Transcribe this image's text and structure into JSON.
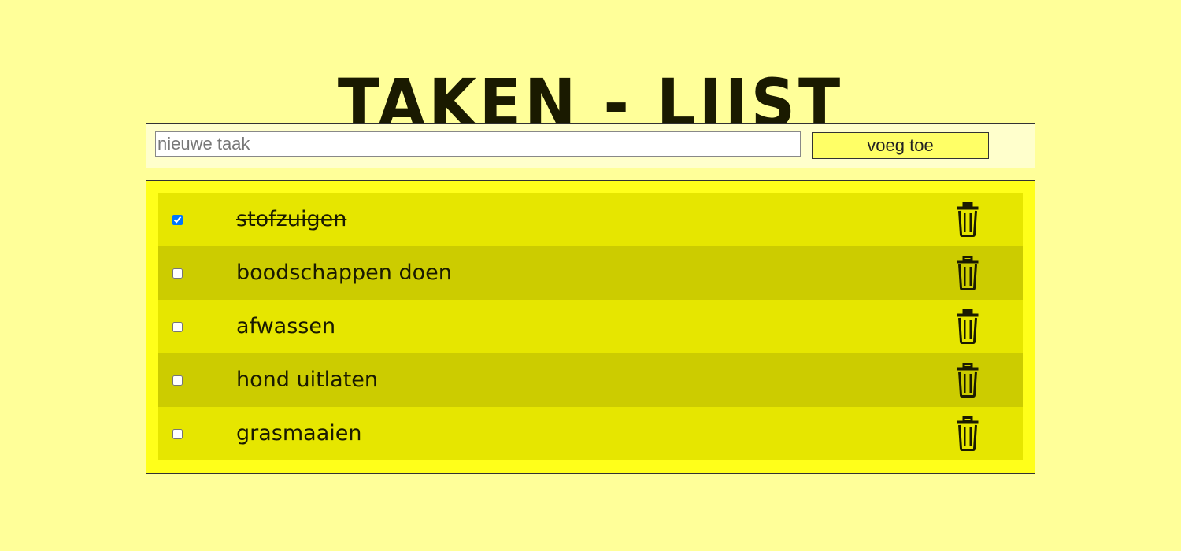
{
  "header": {
    "title": "TAKEN - LIJST"
  },
  "form": {
    "input_placeholder": "nieuwe taak",
    "input_value": "",
    "add_label": "voeg toe"
  },
  "tasks": [
    {
      "label": "stofzuigen",
      "done": true
    },
    {
      "label": "boodschappen doen",
      "done": false
    },
    {
      "label": "afwassen",
      "done": false
    },
    {
      "label": "hond uitlaten",
      "done": false
    },
    {
      "label": "grasmaaien",
      "done": false
    }
  ],
  "icons": {
    "delete": "trash-icon"
  },
  "colors": {
    "background": "#ffff99",
    "row_light": "#e6e600",
    "row_dark": "#cccc00",
    "panel": "#ffff1a",
    "button": "#ffff66"
  }
}
